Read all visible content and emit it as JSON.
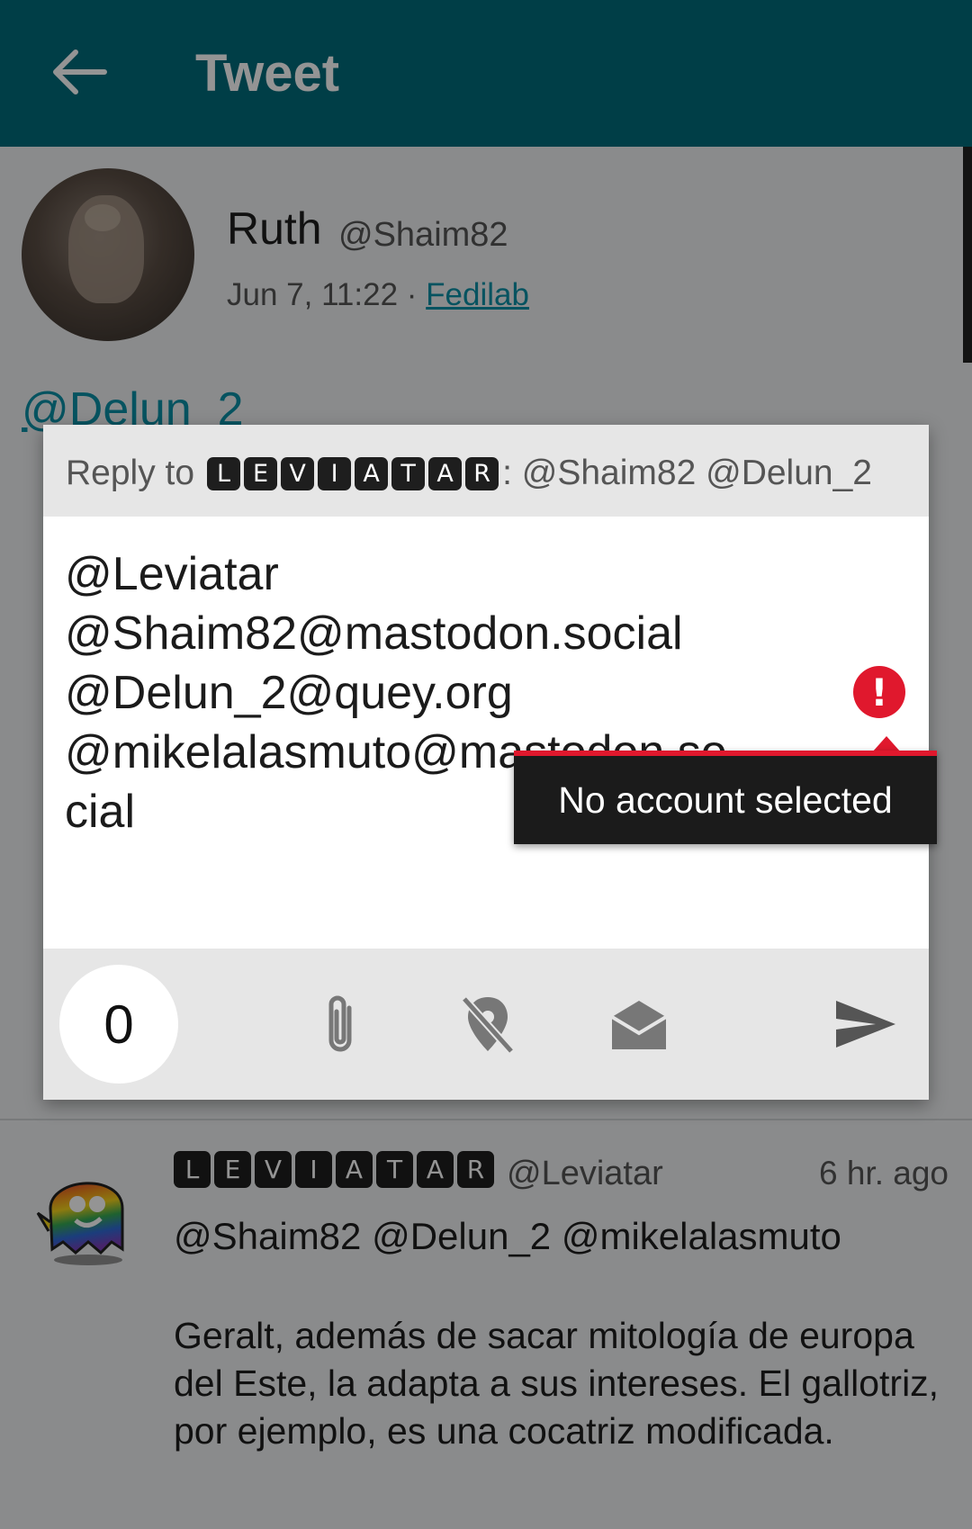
{
  "appbar": {
    "title": "Tweet",
    "back_icon": "arrow-left-icon"
  },
  "tweet": {
    "name": "Ruth",
    "handle": "@Shaim82",
    "date": "Jun 7, 11:22 ·",
    "app": "Fedilab",
    "mention_top": "@Delun_2"
  },
  "reply_dialog": {
    "reply_to_label": "Reply to",
    "badge_letters": [
      "L",
      "E",
      "V",
      "I",
      "A",
      "T",
      "A",
      "R"
    ],
    "reply_to_handles": ": @Shaim82 @Delun_2",
    "compose_lines": [
      "@Leviatar",
      "@Shaim82@mastodon.social",
      "@Delun_2@quey.org",
      "@mikelalasmuto@mastodon.so",
      "cial"
    ],
    "error_icon": "exclamation-icon",
    "tooltip": "No account selected",
    "counter": "0",
    "tools": [
      "paperclip-icon",
      "location-off-icon",
      "envelope-open-icon",
      "send-icon"
    ]
  },
  "reply_item": {
    "badge_letters": [
      "L",
      "E",
      "V",
      "I",
      "A",
      "T",
      "A",
      "R"
    ],
    "handle": "@Leviatar",
    "time": "6 hr. ago",
    "mentions": "@Shaim82 @Delun_2 @mikelalasmuto",
    "body": "Geralt, además de sacar mitología de europa del Este, la adapta a sus intereses. El gallotriz, por ejemplo, es una cocatriz modificada."
  },
  "colors": {
    "appbar": "#006b7a",
    "error": "#e0182d",
    "link": "#0b8fa5"
  }
}
